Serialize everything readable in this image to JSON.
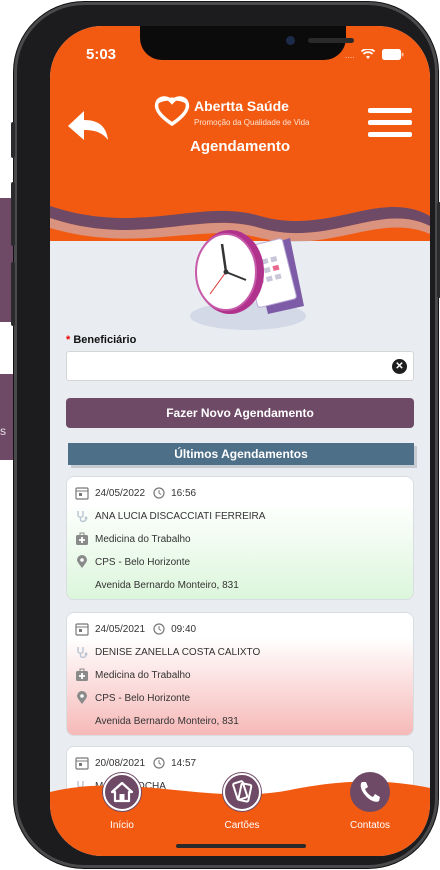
{
  "status_bar": {
    "time": "5:03",
    "signal": "....",
    "wifi": "wifi-icon",
    "battery": "battery-icon"
  },
  "header": {
    "brand_name": "Abertta Saúde",
    "brand_tagline": "Promoção da Qualidade de Vida",
    "title": "Agendamento",
    "back_icon": "arrow-left-icon",
    "menu_icon": "hamburger-icon"
  },
  "form": {
    "label": "Beneficiário",
    "required_mark": "*",
    "value": "",
    "clear_icon": "close-circle-icon"
  },
  "new_button_label": "Fazer Novo Agendamento",
  "section_title": "Últimos Agendamentos",
  "appointments": [
    {
      "date": "24/05/2022",
      "time": "16:56",
      "doctor": "ANA LUCIA DISCACCIATI FERREIRA",
      "specialty": "Medicina do Trabalho",
      "location": "CPS - Belo Horizonte",
      "address": "Avenida Bernardo Monteiro, 831",
      "status_color": "#dcf6db"
    },
    {
      "date": "24/05/2021",
      "time": "09:40",
      "doctor": "DENISE ZANELLA COSTA CALIXTO",
      "specialty": "Medicina do Trabalho",
      "location": "CPS - Belo Horizonte",
      "address": "Avenida Bernardo Monteiro, 831",
      "status_color": "#f6b9b8"
    },
    {
      "date": "20/08/2021",
      "time": "14:57",
      "doctor": "M... ET ROCHA"
    }
  ],
  "nav": {
    "inicio": "Início",
    "cartoes": "Cartões",
    "contatos": "Contatos"
  },
  "callout_text": "s",
  "colors": {
    "primary_orange": "#f25a12",
    "brand_purple": "#6e4a66",
    "section_blue": "#4d6f87"
  }
}
